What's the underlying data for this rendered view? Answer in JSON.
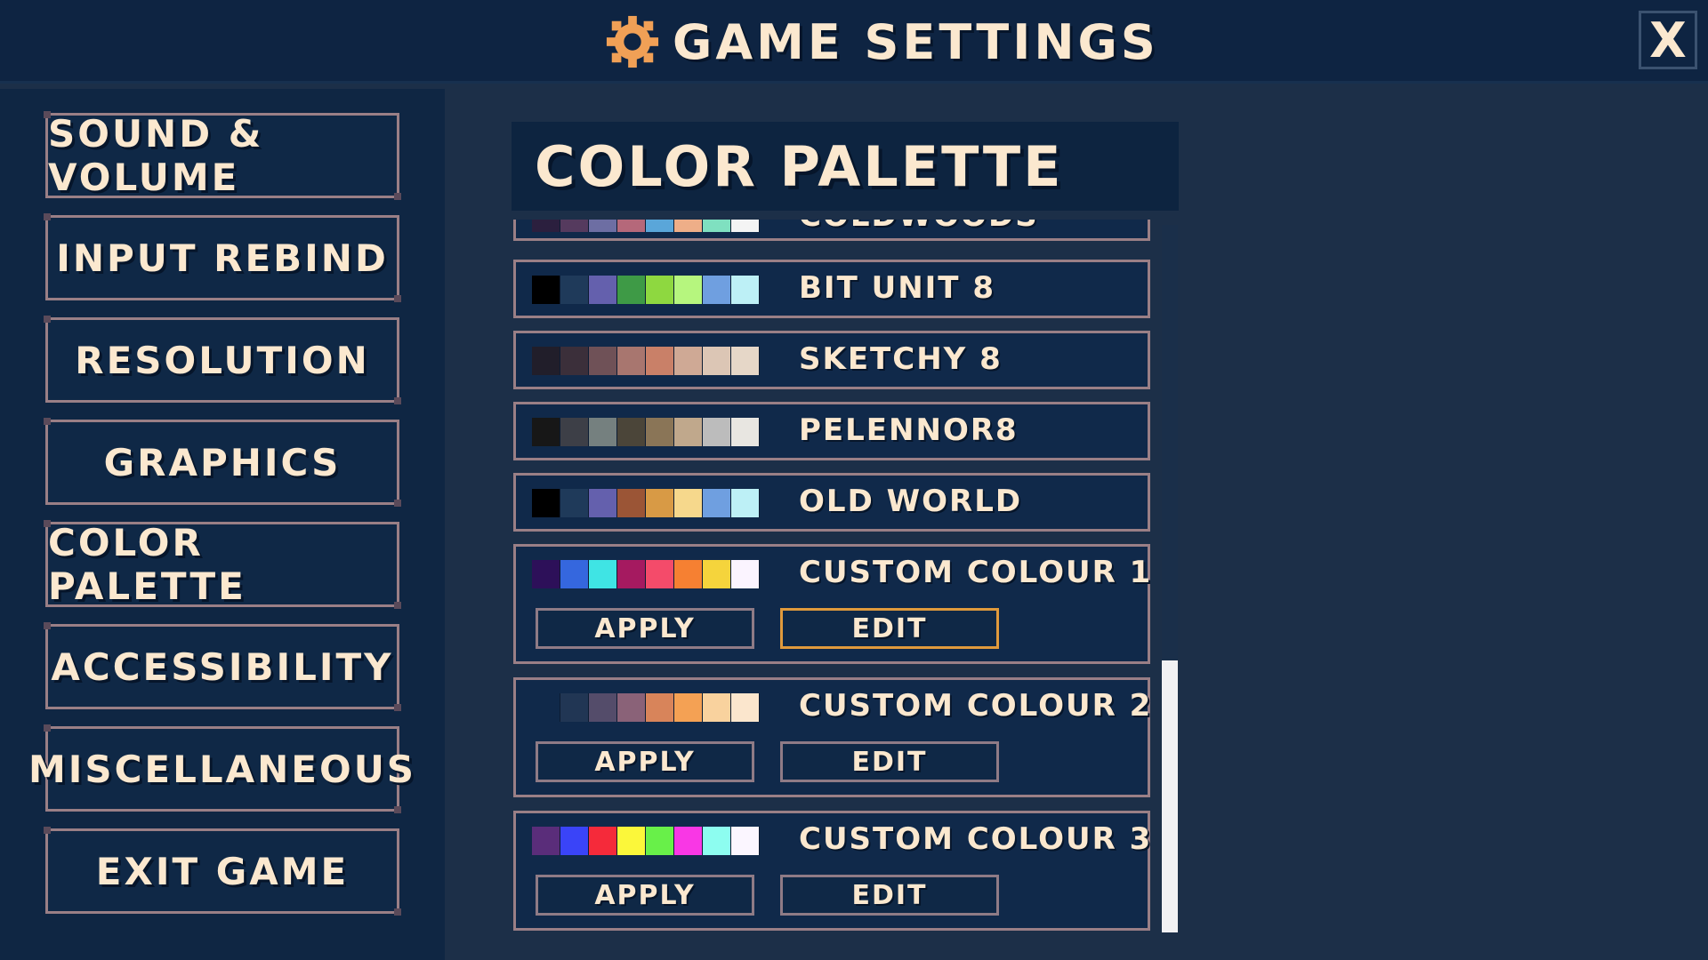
{
  "header": {
    "title": "GAME SETTINGS",
    "close_label": "X"
  },
  "colors": {
    "accent_orange": "#f0a056",
    "cream_text": "#fbe8cf",
    "panel_dark": "#0e2442",
    "selected_border": "#e09a3c"
  },
  "sidebar": {
    "items": [
      {
        "label": "SOUND & VOLUME"
      },
      {
        "label": "INPUT REBIND"
      },
      {
        "label": "RESOLUTION"
      },
      {
        "label": "GRAPHICS"
      },
      {
        "label": "COLOR PALETTE"
      },
      {
        "label": "ACCESSIBILITY"
      },
      {
        "label": "MISCELLANEOUS"
      },
      {
        "label": "EXIT GAME"
      }
    ]
  },
  "panel": {
    "title": "COLOR PALETTE",
    "palettes": [
      {
        "name": "COLDWOODS",
        "colors": [
          "#2b1f3e",
          "#553a5e",
          "#6d6ea3",
          "#b5687a",
          "#5aa6d9",
          "#eeae88",
          "#7fe0c0",
          "#f4f4f4"
        ]
      },
      {
        "name": "BIT UNIT 8",
        "colors": [
          "#000000",
          "#1f3a5a",
          "#6460ad",
          "#3e9a46",
          "#8ed840",
          "#b6f67e",
          "#6f9fe0",
          "#bdf0f6"
        ]
      },
      {
        "name": "SKETCHY 8",
        "colors": [
          "#211e2a",
          "#3b2f3a",
          "#6f5157",
          "#a8766f",
          "#c98068",
          "#cfa995",
          "#dcc6b5",
          "#e6d7c8"
        ]
      },
      {
        "name": "PELENNOR8",
        "colors": [
          "#171717",
          "#3d3f47",
          "#75807f",
          "#4b4539",
          "#8a7557",
          "#c0a88c",
          "#bcbcbc",
          "#e8e6e1"
        ]
      },
      {
        "name": "OLD WORLD",
        "colors": [
          "#000000",
          "#1f3a5a",
          "#6460ad",
          "#9b5536",
          "#d89a45",
          "#f6d88c",
          "#6f9fe0",
          "#bdf0f6"
        ]
      },
      {
        "name": "CUSTOM COLOUR 1",
        "colors": [
          "#2d1059",
          "#3567de",
          "#3fe4e4",
          "#a51a60",
          "#f44b6a",
          "#f68032",
          "#f5d43c",
          "#fbf4ff"
        ],
        "apply_label": "APPLY",
        "edit_label": "EDIT"
      },
      {
        "name": "CUSTOM COLOUR 2",
        "colors": [
          "#10294a",
          "#213654",
          "#544c6a",
          "#8a6278",
          "#d8845a",
          "#f4a154",
          "#f9d29e",
          "#fbe6cd"
        ],
        "apply_label": "APPLY",
        "edit_label": "EDIT"
      },
      {
        "name": "CUSTOM COLOUR 3",
        "colors": [
          "#5a2d7a",
          "#3a44f8",
          "#f52a3a",
          "#fbf73a",
          "#68f049",
          "#f937e5",
          "#8dfdf0",
          "#fbf6ff"
        ],
        "apply_label": "APPLY",
        "edit_label": "EDIT"
      }
    ],
    "selected_button": "CUSTOM COLOUR 1 EDIT",
    "scroll_position": 0.62
  }
}
